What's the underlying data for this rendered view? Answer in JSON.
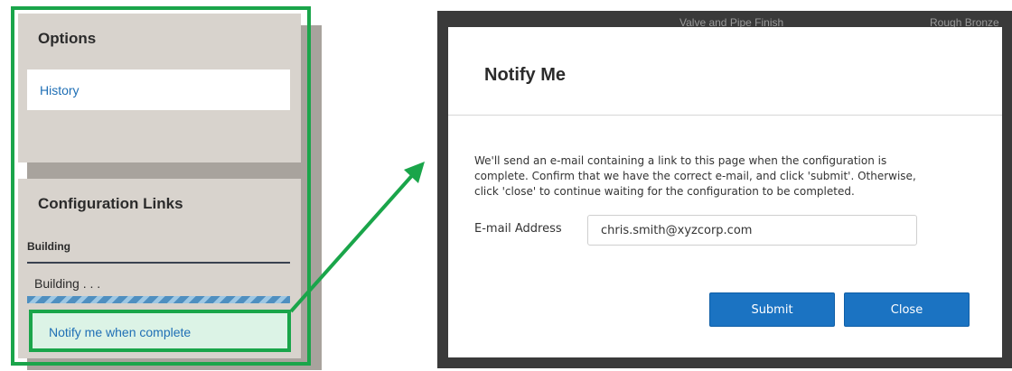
{
  "side_panel": {
    "options": {
      "title": "Options",
      "history_label": "History"
    },
    "configuration_links": {
      "title": "Configuration Links",
      "building_header": "Building",
      "building_status": "Building . . .",
      "notify_label": "Notify me when complete"
    }
  },
  "background": {
    "column_1": "Valve and Pipe Finish",
    "column_2": "Rough Bronze"
  },
  "modal": {
    "title": "Notify Me",
    "message_lines": [
      "We'll send an e-mail containing a link to this page when the configuration is",
      "complete. Confirm that we have the correct e-mail, and click 'submit'. Otherwise,",
      "click 'close' to continue waiting for the configuration to be completed."
    ],
    "email_label": "E-mail Address",
    "email_value": "chris.smith@xyzcorp.com",
    "submit_label": "Submit",
    "close_label": "Close"
  },
  "colors": {
    "highlight": "#1aa54a",
    "link": "#1f6fb5",
    "button": "#1b73c2"
  }
}
